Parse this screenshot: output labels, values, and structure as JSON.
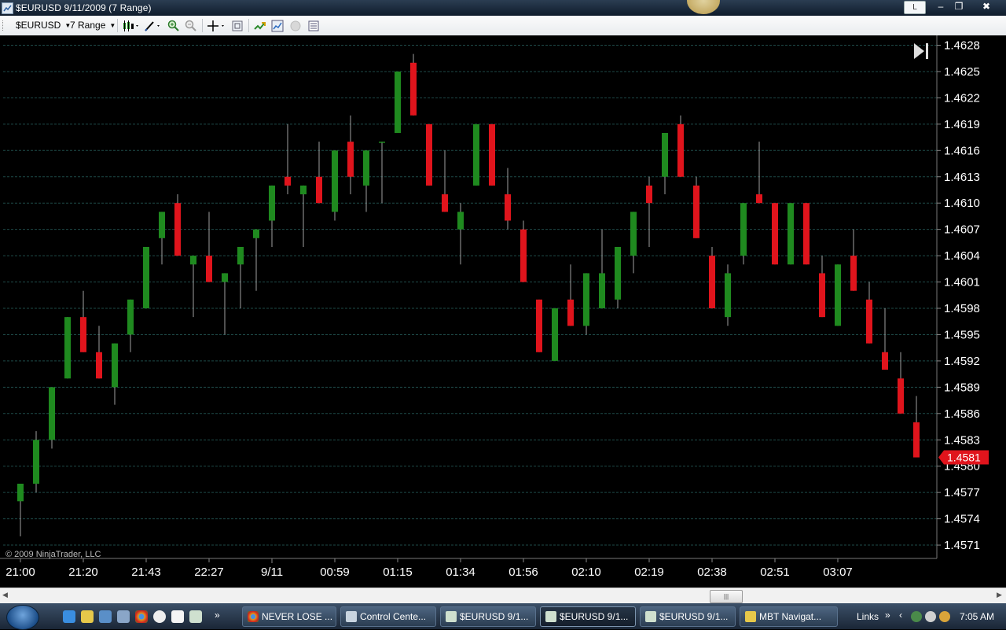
{
  "window": {
    "title": "$EURUSD  9/11/2009 (7 Range)",
    "l_button": "L",
    "minimize": "‒",
    "restore": "❐",
    "close": "✖"
  },
  "toolbar": {
    "instrument": "$EURUSD",
    "interval": "7 Range",
    "icons": [
      "candlestick-style-icon",
      "drawing-tools-icon",
      "zoom-in-icon",
      "zoom-out-icon",
      "crosshair-icon",
      "data-box-icon",
      "indicators-icon",
      "strategies-icon",
      "disabled-icon",
      "properties-icon"
    ]
  },
  "chart_data": {
    "type": "candlestick",
    "instrument": "$EURUSD",
    "interval": "7 Range",
    "watermark": "© 2009 NinjaTrader, LLC",
    "colors": {
      "up": "#1f8a1f",
      "down": "#e0141c",
      "wick": "#a0a0a0",
      "grid": "#1e4a48"
    },
    "y_ticks": [
      "1.4628",
      "1.4625",
      "1.4622",
      "1.4619",
      "1.4616",
      "1.4613",
      "1.4610",
      "1.4607",
      "1.4604",
      "1.4601",
      "1.4598",
      "1.4595",
      "1.4592",
      "1.4589",
      "1.4586",
      "1.4583",
      "1.4580",
      "1.4577",
      "1.4574",
      "1.4571"
    ],
    "x_ticks": [
      "21:00",
      "21:20",
      "21:43",
      "22:27",
      "9/11",
      "00:59",
      "01:15",
      "01:34",
      "01:56",
      "02:10",
      "02:19",
      "02:38",
      "02:51",
      "03:07"
    ],
    "last_price": "1.4581",
    "candles": [
      {
        "o": 1.4576,
        "h": 1.4578,
        "l": 1.4572,
        "c": 1.4578
      },
      {
        "o": 1.4578,
        "h": 1.4584,
        "l": 1.4577,
        "c": 1.4583
      },
      {
        "o": 1.4583,
        "h": 1.4589,
        "l": 1.4582,
        "c": 1.4589
      },
      {
        "o": 1.459,
        "h": 1.4597,
        "l": 1.459,
        "c": 1.4597
      },
      {
        "o": 1.4597,
        "h": 1.46,
        "l": 1.4593,
        "c": 1.4593
      },
      {
        "o": 1.4593,
        "h": 1.4596,
        "l": 1.459,
        "c": 1.459
      },
      {
        "o": 1.4589,
        "h": 1.4594,
        "l": 1.4587,
        "c": 1.4594
      },
      {
        "o": 1.4595,
        "h": 1.4599,
        "l": 1.4593,
        "c": 1.4599
      },
      {
        "o": 1.4598,
        "h": 1.4605,
        "l": 1.4598,
        "c": 1.4605
      },
      {
        "o": 1.4606,
        "h": 1.4609,
        "l": 1.4603,
        "c": 1.4609
      },
      {
        "o": 1.461,
        "h": 1.4611,
        "l": 1.4604,
        "c": 1.4604
      },
      {
        "o": 1.4603,
        "h": 1.4604,
        "l": 1.4597,
        "c": 1.4604
      },
      {
        "o": 1.4604,
        "h": 1.4609,
        "l": 1.4601,
        "c": 1.4601
      },
      {
        "o": 1.4601,
        "h": 1.4602,
        "l": 1.4595,
        "c": 1.4602
      },
      {
        "o": 1.4603,
        "h": 1.4605,
        "l": 1.4598,
        "c": 1.4605
      },
      {
        "o": 1.4606,
        "h": 1.4607,
        "l": 1.46,
        "c": 1.4607
      },
      {
        "o": 1.4608,
        "h": 1.4612,
        "l": 1.4605,
        "c": 1.4612
      },
      {
        "o": 1.4613,
        "h": 1.4619,
        "l": 1.4611,
        "c": 1.4612
      },
      {
        "o": 1.4611,
        "h": 1.4612,
        "l": 1.4605,
        "c": 1.4612
      },
      {
        "o": 1.4613,
        "h": 1.4617,
        "l": 1.461,
        "c": 1.461
      },
      {
        "o": 1.4609,
        "h": 1.4616,
        "l": 1.4608,
        "c": 1.4616
      },
      {
        "o": 1.4617,
        "h": 1.462,
        "l": 1.4611,
        "c": 1.4613
      },
      {
        "o": 1.4612,
        "h": 1.4616,
        "l": 1.4609,
        "c": 1.4616
      },
      {
        "o": 1.4617,
        "h": 1.4617,
        "l": 1.461,
        "c": 1.4617
      },
      {
        "o": 1.4618,
        "h": 1.4625,
        "l": 1.4618,
        "c": 1.4625
      },
      {
        "o": 1.4626,
        "h": 1.4627,
        "l": 1.462,
        "c": 1.462
      },
      {
        "o": 1.4619,
        "h": 1.4619,
        "l": 1.4612,
        "c": 1.4612
      },
      {
        "o": 1.4611,
        "h": 1.4616,
        "l": 1.4609,
        "c": 1.4609
      },
      {
        "o": 1.4607,
        "h": 1.461,
        "l": 1.4603,
        "c": 1.4609
      },
      {
        "o": 1.4612,
        "h": 1.4619,
        "l": 1.4612,
        "c": 1.4619
      },
      {
        "o": 1.4619,
        "h": 1.4619,
        "l": 1.4612,
        "c": 1.4612
      },
      {
        "o": 1.4611,
        "h": 1.4614,
        "l": 1.4607,
        "c": 1.4608
      },
      {
        "o": 1.4607,
        "h": 1.4608,
        "l": 1.4601,
        "c": 1.4601
      },
      {
        "o": 1.4599,
        "h": 1.4599,
        "l": 1.4593,
        "c": 1.4593
      },
      {
        "o": 1.4592,
        "h": 1.4598,
        "l": 1.4592,
        "c": 1.4598
      },
      {
        "o": 1.4599,
        "h": 1.4603,
        "l": 1.4596,
        "c": 1.4596
      },
      {
        "o": 1.4596,
        "h": 1.4602,
        "l": 1.4595,
        "c": 1.4602
      },
      {
        "o": 1.4598,
        "h": 1.4607,
        "l": 1.4598,
        "c": 1.4602
      },
      {
        "o": 1.4599,
        "h": 1.4605,
        "l": 1.4598,
        "c": 1.4605
      },
      {
        "o": 1.4604,
        "h": 1.4609,
        "l": 1.4602,
        "c": 1.4609
      },
      {
        "o": 1.4612,
        "h": 1.4613,
        "l": 1.4605,
        "c": 1.461
      },
      {
        "o": 1.4613,
        "h": 1.4618,
        "l": 1.4611,
        "c": 1.4618
      },
      {
        "o": 1.4619,
        "h": 1.462,
        "l": 1.4613,
        "c": 1.4613
      },
      {
        "o": 1.4612,
        "h": 1.4613,
        "l": 1.4606,
        "c": 1.4606
      },
      {
        "o": 1.4604,
        "h": 1.4605,
        "l": 1.4598,
        "c": 1.4598
      },
      {
        "o": 1.4597,
        "h": 1.4603,
        "l": 1.4596,
        "c": 1.4602
      },
      {
        "o": 1.4604,
        "h": 1.461,
        "l": 1.4603,
        "c": 1.461
      },
      {
        "o": 1.4611,
        "h": 1.4617,
        "l": 1.461,
        "c": 1.461
      },
      {
        "o": 1.461,
        "h": 1.461,
        "l": 1.4603,
        "c": 1.4603
      },
      {
        "o": 1.4603,
        "h": 1.461,
        "l": 1.4603,
        "c": 1.461
      },
      {
        "o": 1.461,
        "h": 1.461,
        "l": 1.4603,
        "c": 1.4603
      },
      {
        "o": 1.4602,
        "h": 1.4604,
        "l": 1.4597,
        "c": 1.4597
      },
      {
        "o": 1.4596,
        "h": 1.4603,
        "l": 1.4596,
        "c": 1.4603
      },
      {
        "o": 1.4604,
        "h": 1.4607,
        "l": 1.46,
        "c": 1.46
      },
      {
        "o": 1.4599,
        "h": 1.4601,
        "l": 1.4594,
        "c": 1.4594
      },
      {
        "o": 1.4593,
        "h": 1.4598,
        "l": 1.4591,
        "c": 1.4591
      },
      {
        "o": 1.459,
        "h": 1.4593,
        "l": 1.4586,
        "c": 1.4586
      },
      {
        "o": 1.4585,
        "h": 1.4588,
        "l": 1.4581,
        "c": 1.4581
      }
    ]
  },
  "scrollbar": {
    "left_arrow": "◀",
    "right_arrow": "▶",
    "grip": "|||"
  },
  "taskbar": {
    "tasks": [
      {
        "label": "NEVER LOSE ...",
        "active": false
      },
      {
        "label": "Control Cente...",
        "active": false
      },
      {
        "label": "$EURUSD  9/1...",
        "active": false
      },
      {
        "label": "$EURUSD  9/1...",
        "active": true
      },
      {
        "label": "$EURUSD  9/1...",
        "active": false
      },
      {
        "label": "MBT Navigat...",
        "active": false
      }
    ],
    "quicklaunch_chevron": "»",
    "links": "Links",
    "links_chevron": "»",
    "tray_chevron": "‹",
    "clock": "7:05 AM"
  }
}
